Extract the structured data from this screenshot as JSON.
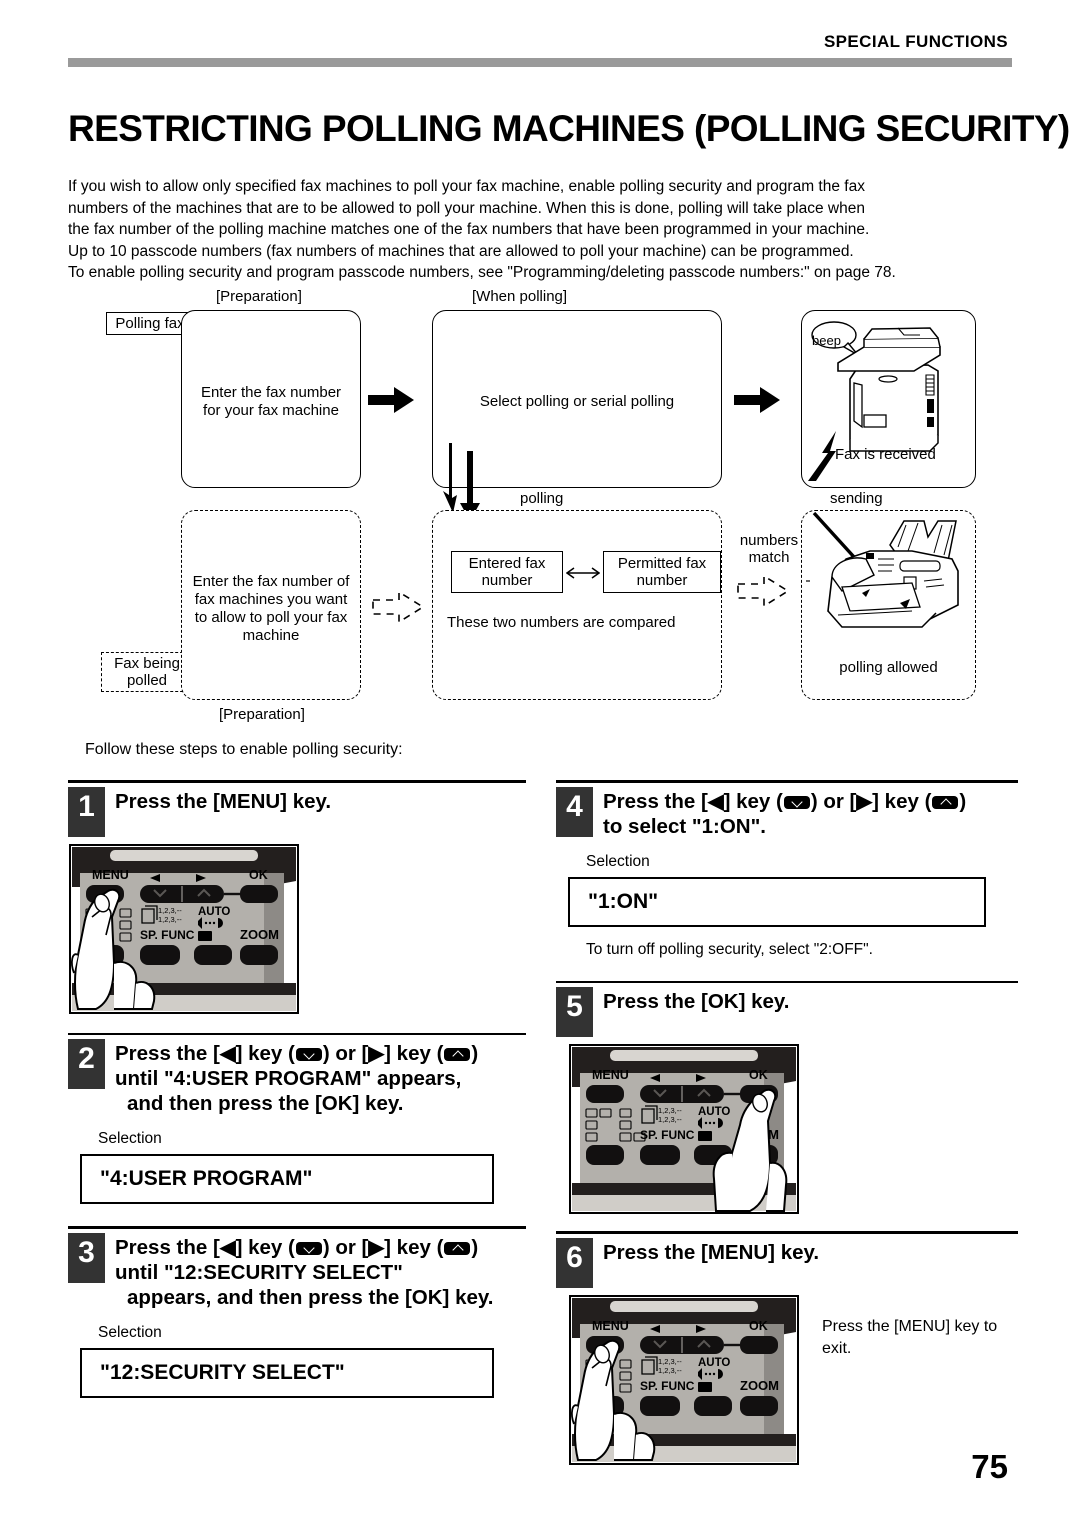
{
  "header": {
    "section_label": "SPECIAL FUNCTIONS",
    "title": "RESTRICTING POLLING MACHINES (POLLING SECURITY)"
  },
  "intro": {
    "line1": "If you wish to allow only specified fax machines to poll your fax machine, enable polling security and program the fax",
    "line2": "numbers of the machines that are to be allowed to poll your machine. When this is done, polling will take place when",
    "line3": "the fax number of the polling machine matches one of the fax numbers that have been programmed in your machine.",
    "line4": "Up to 10 passcode numbers (fax numbers of machines that are allowed to poll your machine) can be programmed.",
    "line5": "To enable polling security and program passcode numbers, see \"Programming/deleting passcode numbers:\" on page 78."
  },
  "diagram": {
    "caption_preparation_top": "[Preparation]",
    "caption_when_polling": "[When polling]",
    "caption_preparation_bottom": "[Preparation]",
    "tag_polling_fax": "Polling fax",
    "tag_fax_being_polled_l1": "Fax being",
    "tag_fax_being_polled_l2": "polled",
    "box_enter_fax_l1": "Enter the fax number",
    "box_enter_fax_l2": "for your fax machine",
    "box_select_polling": "Select polling or serial polling",
    "box_enter_allowed_l1": "Enter the fax number of",
    "box_enter_allowed_l2": "fax machines you want",
    "box_enter_allowed_l3": "to allow to poll your fax",
    "box_enter_allowed_l4": "machine",
    "label_polling": "polling",
    "label_sending": "sending",
    "label_beep": "beep",
    "label_fax_received": "Fax is received",
    "label_numbers_match_l1": "numbers",
    "label_numbers_match_l2": "match",
    "label_polling_allowed": "polling allowed",
    "box_entered_fax_l1": "Entered fax",
    "box_entered_fax_l2": "number",
    "box_permitted_fax_l1": "Permitted fax",
    "box_permitted_fax_l2": "number",
    "label_compared": "These two numbers are compared"
  },
  "follow_line": "Follow these steps to enable polling security:",
  "steps": {
    "step1": {
      "num": "1",
      "title": "Press the [MENU] key."
    },
    "step2": {
      "num": "2",
      "title_a": "Press the [",
      "title_b": "] key (",
      "title_c": ") or [",
      "title_d": "] key (",
      "title_e": ")",
      "line2": "until \"4:USER PROGRAM\" appears,",
      "line3": "and then press the [OK] key.",
      "selection_label": "Selection",
      "selection_value": "\"4:USER PROGRAM\""
    },
    "step3": {
      "num": "3",
      "line2": "until \"12:SECURITY SELECT\"",
      "line3": "appears, and then press the [OK] key.",
      "selection_label": "Selection",
      "selection_value": "\"12:SECURITY SELECT\""
    },
    "step4": {
      "num": "4",
      "line2": "to select \"1:ON\".",
      "selection_label": "Selection",
      "selection_value": "\"1:ON\"",
      "note": "To turn off polling security, select \"2:OFF\"."
    },
    "step5": {
      "num": "5",
      "title": "Press the [OK] key."
    },
    "step6": {
      "num": "6",
      "title": "Press the [MENU] key.",
      "sidenote_l1": "Press the [MENU] key to",
      "sidenote_l2": "exit."
    }
  },
  "panel": {
    "menu": "MENU",
    "ok": "OK",
    "sp_func": "SP. FUNC",
    "zoom": "ZOOM",
    "auto": "AUTO",
    "digits1": "1,2,3,--",
    "digits2": "1,2,3,--"
  },
  "page_number": "75",
  "colors": {
    "header_rule": "#9a9a9a",
    "step_badge": "#333333",
    "panel_body": "#b3b0ab",
    "panel_dark": "#231f1e",
    "key_black": "#121010"
  }
}
